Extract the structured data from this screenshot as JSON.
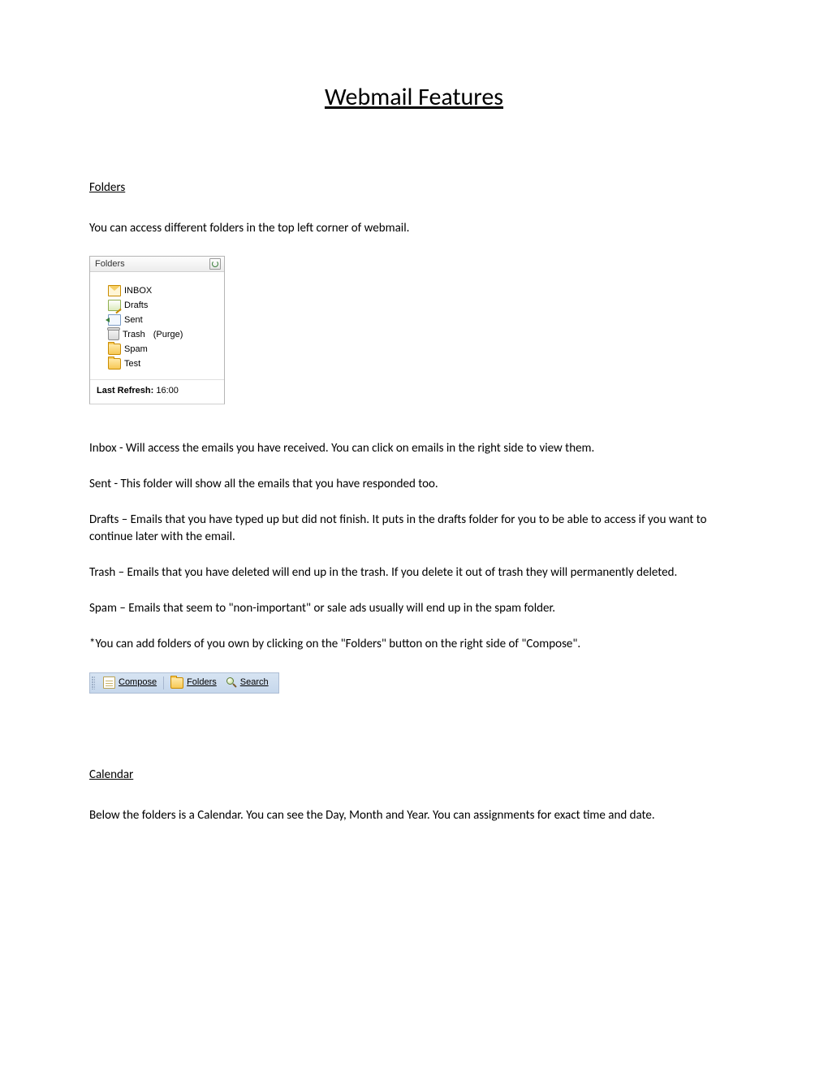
{
  "title": "Webmail Features",
  "section_folders": "Folders",
  "folders_intro": "You can access different folders in the top left corner of webmail.",
  "panel": {
    "header": "Folders",
    "items": {
      "inbox": "INBOX",
      "drafts": "Drafts",
      "sent": "Sent",
      "trash": "Trash",
      "trash_purge": "(Purge)",
      "spam": "Spam",
      "test": "Test"
    },
    "last_refresh_label": "Last Refresh:",
    "last_refresh_time": "16:00"
  },
  "desc": {
    "inbox": " Inbox -  Will access the emails you have received. You can click on emails in the right side to view them.",
    "sent": "Sent - This folder will show all the emails that you have responded too.",
    "drafts": "Drafts – Emails that you have typed up but did not finish. It puts in the drafts folder for you to be able to access if you want to continue later with the email.",
    "trash": "Trash – Emails that you have deleted will end up in the trash. If you delete it out of trash they will permanently deleted.",
    "spam": "Spam – Emails that seem to \"non-important\" or sale ads usually will end up in the spam folder.",
    "note": "*You can add folders of you own by clicking on the \"Folders\" button on the right side of \"Compose\"."
  },
  "toolbar": {
    "compose": "Compose",
    "folders": "Folders",
    "search": "Search"
  },
  "section_calendar": "Calendar",
  "calendar_body": "Below the folders is a Calendar. You can see the Day, Month and Year. You can assignments for exact time and date."
}
